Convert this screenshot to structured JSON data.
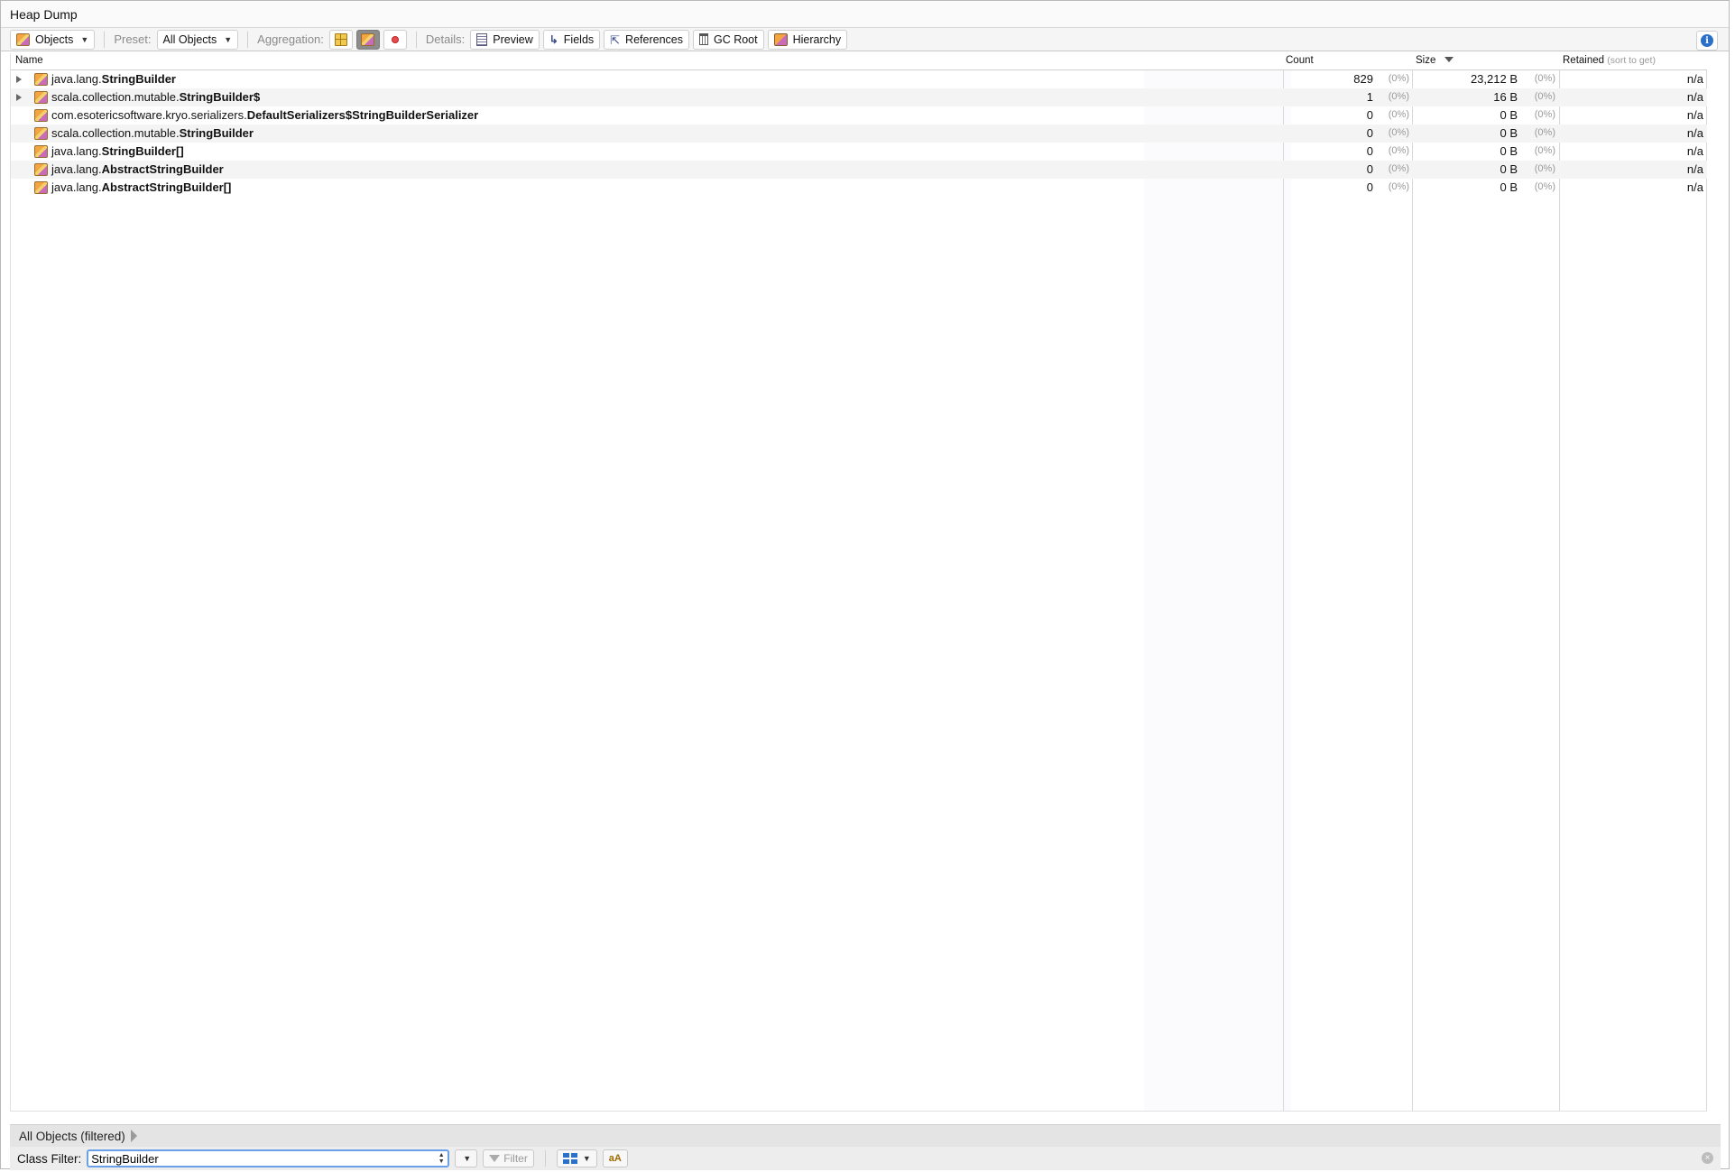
{
  "window": {
    "title": "Heap Dump"
  },
  "toolbar": {
    "view_label": "Objects",
    "preset_label": "Preset:",
    "preset_value": "All Objects",
    "aggregation_label": "Aggregation:",
    "details_label": "Details:",
    "buttons": {
      "preview": "Preview",
      "fields": "Fields",
      "references": "References",
      "gc_root": "GC Root",
      "hierarchy": "Hierarchy"
    }
  },
  "table": {
    "columns": {
      "name": "Name",
      "count": "Count",
      "size": "Size",
      "retained": "Retained",
      "retained_hint": "(sort to get)"
    },
    "rows": [
      {
        "pkg": "java.lang.",
        "cls": "StringBuilder",
        "count": "829",
        "count_pct": "(0%)",
        "size": "23,212 B",
        "size_pct": "(0%)",
        "retained": "n/a",
        "expandable": true
      },
      {
        "pkg": "scala.collection.mutable.",
        "cls": "StringBuilder$",
        "count": "1",
        "count_pct": "(0%)",
        "size": "16 B",
        "size_pct": "(0%)",
        "retained": "n/a",
        "expandable": true
      },
      {
        "pkg": "com.esotericsoftware.kryo.serializers.",
        "cls": "DefaultSerializers$StringBuilderSerializer",
        "count": "0",
        "count_pct": "(0%)",
        "size": "0 B",
        "size_pct": "(0%)",
        "retained": "n/a",
        "expandable": false
      },
      {
        "pkg": "scala.collection.mutable.",
        "cls": "StringBuilder",
        "count": "0",
        "count_pct": "(0%)",
        "size": "0 B",
        "size_pct": "(0%)",
        "retained": "n/a",
        "expandable": false
      },
      {
        "pkg": "java.lang.",
        "cls": "StringBuilder[]",
        "count": "0",
        "count_pct": "(0%)",
        "size": "0 B",
        "size_pct": "(0%)",
        "retained": "n/a",
        "expandable": false
      },
      {
        "pkg": "java.lang.",
        "cls": "AbstractStringBuilder",
        "count": "0",
        "count_pct": "(0%)",
        "size": "0 B",
        "size_pct": "(0%)",
        "retained": "n/a",
        "expandable": false
      },
      {
        "pkg": "java.lang.",
        "cls": "AbstractStringBuilder[]",
        "count": "0",
        "count_pct": "(0%)",
        "size": "0 B",
        "size_pct": "(0%)",
        "retained": "n/a",
        "expandable": false
      }
    ]
  },
  "breadcrumb": {
    "label": "All Objects (filtered)"
  },
  "filter": {
    "label": "Class Filter:",
    "value": "StringBuilder",
    "button_label": "Filter"
  }
}
